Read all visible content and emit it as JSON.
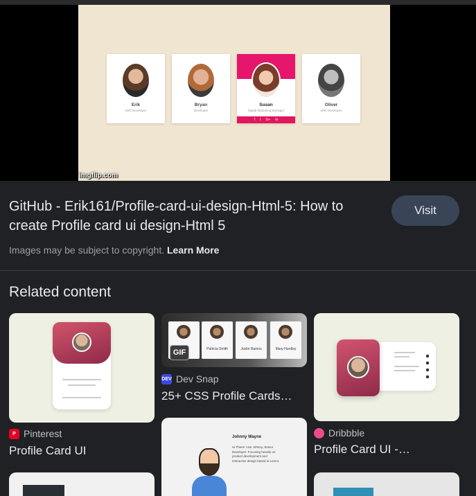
{
  "preview": {
    "watermark": "imgflip.com",
    "cards": [
      {
        "name": "Erik",
        "role": "Web Developer"
      },
      {
        "name": "Bryan",
        "role": "Developer"
      },
      {
        "name": "Susan",
        "role": "Digital Marketing Manager",
        "social": [
          "f",
          "t",
          "G+",
          "in"
        ]
      },
      {
        "name": "Oliver",
        "role": "Web Developer"
      }
    ]
  },
  "result": {
    "title": "GitHub - Erik161/Profile-card-ui-design-Html-5: How to create Profile card ui design-Html 5",
    "visit_label": "Visit",
    "copyright_text": "Images may be subject to copyright.",
    "learn_more": "Learn More"
  },
  "related": {
    "heading": "Related content",
    "items": [
      {
        "source": "Pinterest",
        "source_icon": "pinterest-icon",
        "title": "Profile Card UI",
        "color": "#e60023"
      },
      {
        "source": "Dev Snap",
        "source_icon": "dev-icon",
        "title": "25+ CSS Profile Cards…",
        "color": "#3b49df"
      },
      {
        "source": "Dribbble",
        "source_icon": "dribbble-icon",
        "title": "Profile Card UI -…",
        "color": "#ea4c89"
      }
    ],
    "devsnap_cards": [
      "Patricia Smith",
      "Justin Ramos",
      "Mary Hurdley"
    ],
    "gif_badge": "GIF",
    "portfolio": {
      "name": "Johnny Wayne",
      "bio": "Hi There! I am Johnny, Senior Developer. Focusing heavily on product development and interactive design based in Lemni."
    }
  }
}
